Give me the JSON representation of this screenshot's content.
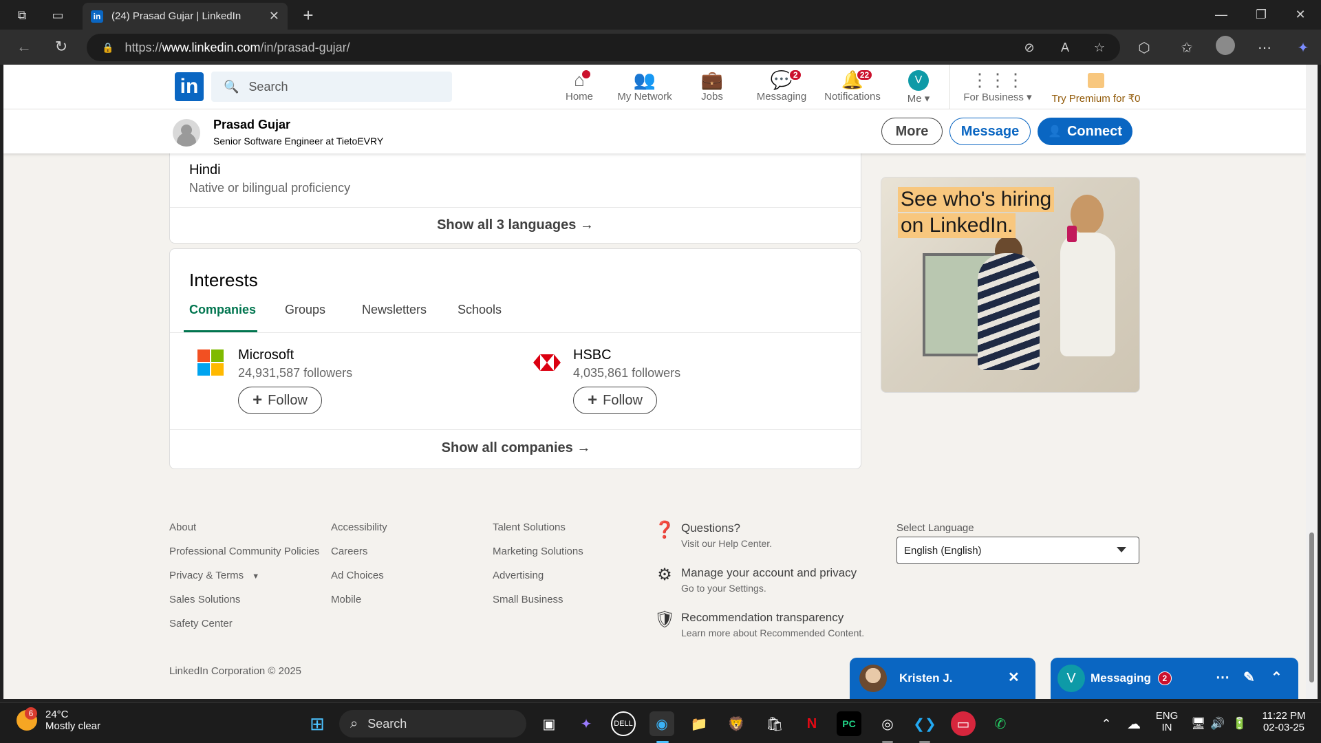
{
  "browser": {
    "tab_title": "(24) Prasad Gujar | LinkedIn",
    "tab_favicon": "in",
    "url_prefix": "https://",
    "url_host": "www.linkedin.com",
    "url_path": "/in/prasad-gujar/"
  },
  "nav": {
    "logo": "in",
    "search_placeholder": "Search",
    "items": [
      {
        "label": "Home",
        "icon": "home-icon",
        "badge": ""
      },
      {
        "label": "My Network",
        "icon": "network-icon",
        "badge": ""
      },
      {
        "label": "Jobs",
        "icon": "briefcase-icon",
        "badge": ""
      },
      {
        "label": "Messaging",
        "icon": "messaging-icon",
        "badge": "2"
      },
      {
        "label": "Notifications",
        "icon": "bell-icon",
        "badge": "22"
      },
      {
        "label": "Me",
        "icon": "avatar",
        "badge": ""
      }
    ],
    "me_initial": "V",
    "for_business": "For Business",
    "premium": "Try Premium for ₹0"
  },
  "profile_bar": {
    "name": "Prasad Gujar",
    "headline": "Senior Software Engineer at TietoEVRY",
    "more": "More",
    "message": "Message",
    "connect": "Connect"
  },
  "languages": {
    "name": "Hindi",
    "level": "Native or bilingual proficiency",
    "show_all": "Show all 3 languages →"
  },
  "interests": {
    "title": "Interests",
    "tabs": [
      "Companies",
      "Groups",
      "Newsletters",
      "Schools"
    ],
    "companies": [
      {
        "name": "Microsoft",
        "followers": "24,931,587 followers",
        "follow": "Follow"
      },
      {
        "name": "HSBC",
        "followers": "4,035,861 followers",
        "follow": "Follow"
      }
    ],
    "show_all": "Show all companies →"
  },
  "ad": {
    "line1": "See who's hiring",
    "line2": "on LinkedIn."
  },
  "footer": {
    "col1": [
      "About",
      "Professional Community Policies",
      "Privacy & Terms",
      "Sales Solutions",
      "Safety Center"
    ],
    "col2": [
      "Accessibility",
      "Careers",
      "Ad Choices",
      "Mobile"
    ],
    "col3": [
      "Talent Solutions",
      "Marketing Solutions",
      "Advertising",
      "Small Business"
    ],
    "help": [
      {
        "title": "Questions?",
        "sub": "Visit our Help Center."
      },
      {
        "title": "Manage your account and privacy",
        "sub": "Go to your Settings."
      },
      {
        "title": "Recommendation transparency",
        "sub": "Learn more about Recommended Content."
      }
    ],
    "select_language_label": "Select Language",
    "selected_language": "English (English)",
    "copyright": "LinkedIn Corporation © 2025"
  },
  "messaging": {
    "chat_name": "Kristen J.",
    "title": "Messaging",
    "badge": "2",
    "initial": "V"
  },
  "taskbar": {
    "weather_temp": "24°C",
    "weather_desc": "Mostly clear",
    "weather_badge": "6",
    "search": "Search",
    "lang1": "ENG",
    "lang2": "IN",
    "time": "11:22 PM",
    "date": "02-03-25"
  },
  "colors": {
    "linkedin_blue": "#0a66c2",
    "active_tab_green": "#01754f",
    "badge_red": "#cb112d",
    "premium_gold": "#f8c77e"
  }
}
